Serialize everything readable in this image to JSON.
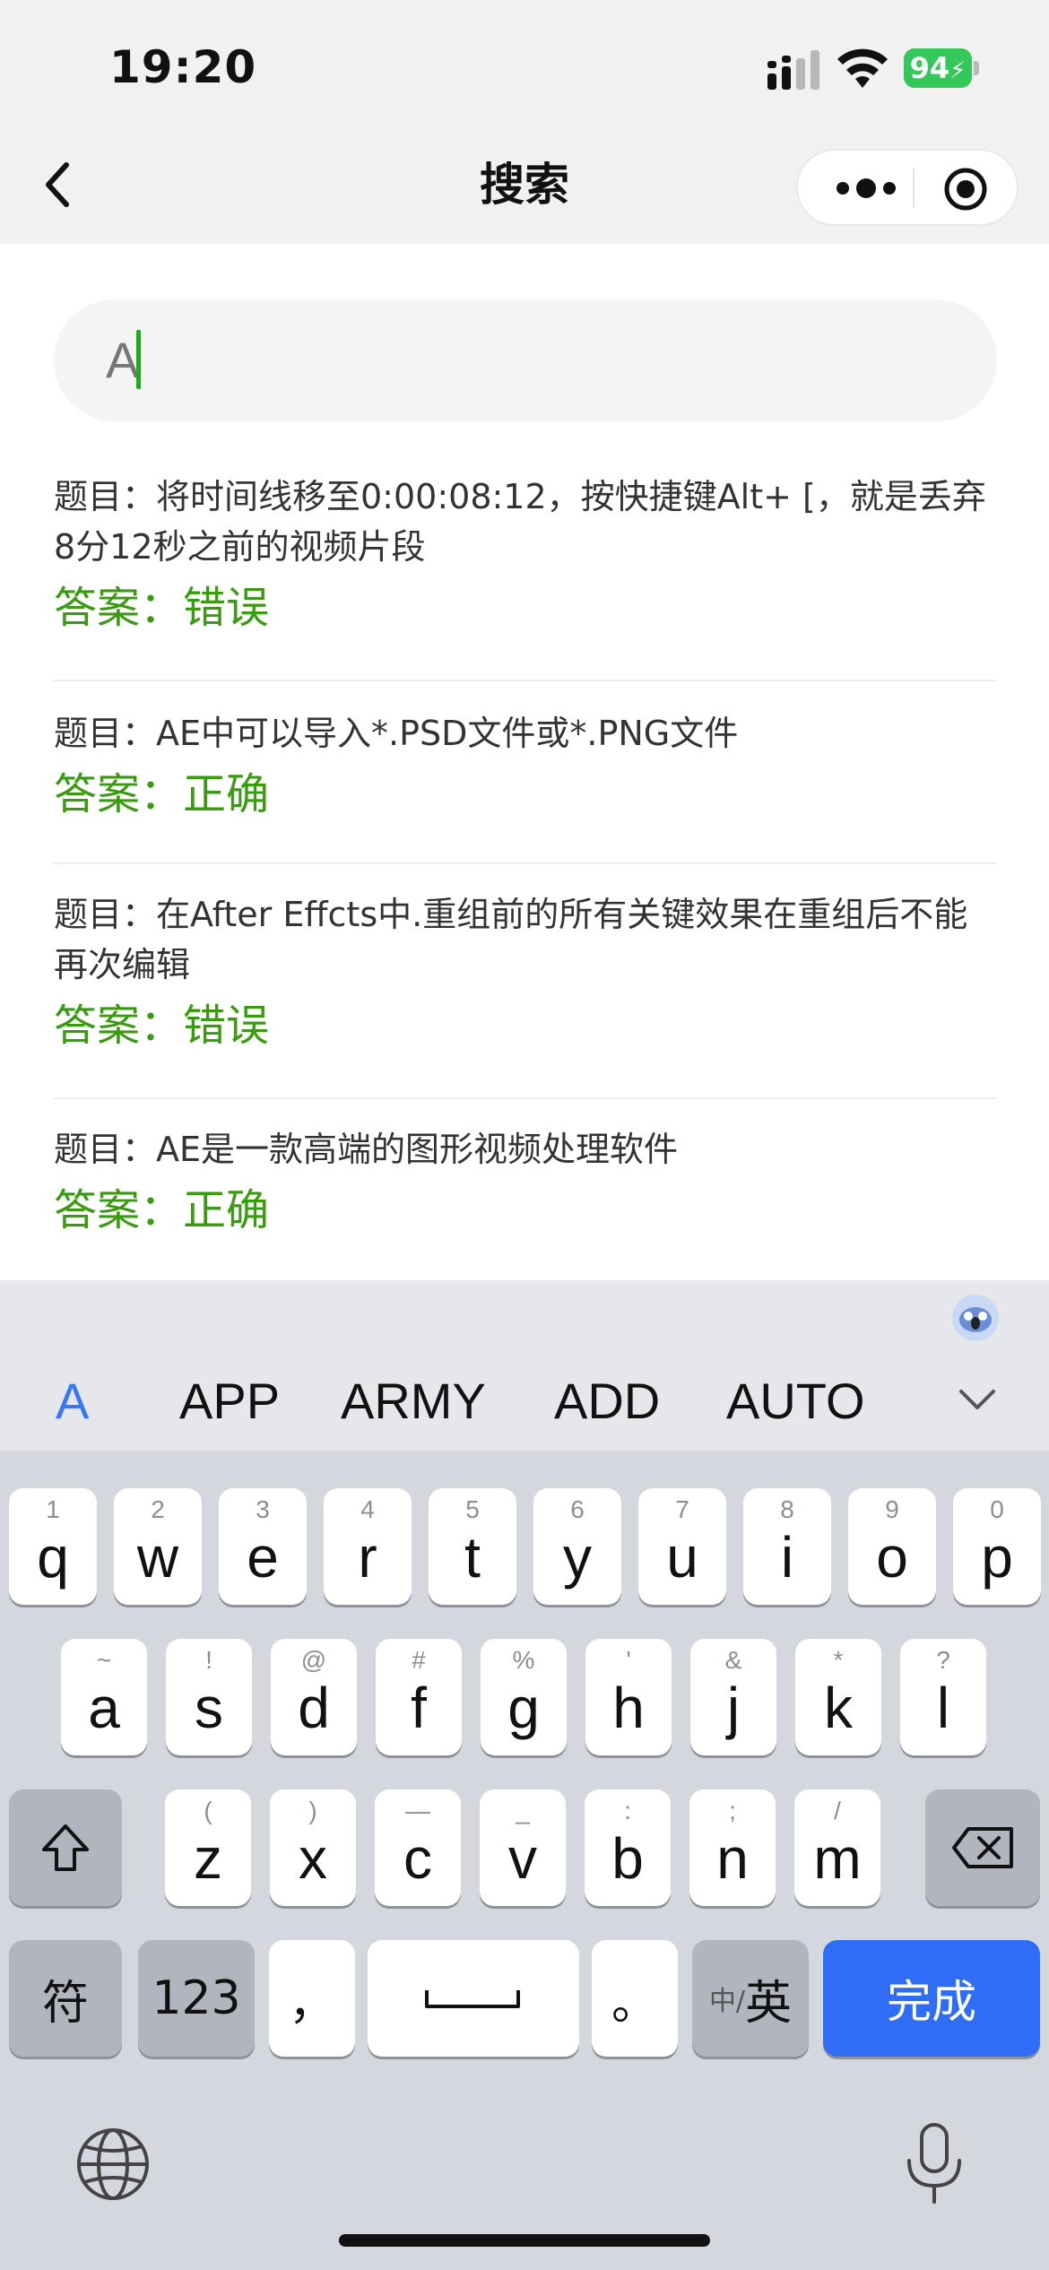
{
  "status_bar": {
    "time": "19:20",
    "battery": "94"
  },
  "nav": {
    "title": "搜索"
  },
  "search": {
    "value": "A"
  },
  "results": [
    {
      "question": "题目：将时间线移至0:00:08:12，按快捷键Alt+ [，就是丢弃8分12秒之前的视频片段",
      "answer": "答案：错误"
    },
    {
      "question": "题目：AE中可以导入*.PSD文件或*.PNG文件",
      "answer": "答案：正确"
    },
    {
      "question": "题目：在After Effcts中.重组前的所有关键效果在重组后不能再次编辑",
      "answer": "答案：错误"
    },
    {
      "question": "题目：AE是一款高端的图形视频处理软件",
      "answer": "答案：正确"
    }
  ],
  "keyboard": {
    "suggestions": [
      "A",
      "APP",
      "ARMY",
      "ADD",
      "AUTO"
    ],
    "row1": [
      {
        "k": "q",
        "h": "1"
      },
      {
        "k": "w",
        "h": "2"
      },
      {
        "k": "e",
        "h": "3"
      },
      {
        "k": "r",
        "h": "4"
      },
      {
        "k": "t",
        "h": "5"
      },
      {
        "k": "y",
        "h": "6"
      },
      {
        "k": "u",
        "h": "7"
      },
      {
        "k": "i",
        "h": "8"
      },
      {
        "k": "o",
        "h": "9"
      },
      {
        "k": "p",
        "h": "0"
      }
    ],
    "row2": [
      {
        "k": "a",
        "h": "~"
      },
      {
        "k": "s",
        "h": "!"
      },
      {
        "k": "d",
        "h": "@"
      },
      {
        "k": "f",
        "h": "#"
      },
      {
        "k": "g",
        "h": "%"
      },
      {
        "k": "h",
        "h": "'"
      },
      {
        "k": "j",
        "h": "&"
      },
      {
        "k": "k",
        "h": "*"
      },
      {
        "k": "l",
        "h": "?"
      }
    ],
    "row3": [
      {
        "k": "z",
        "h": "("
      },
      {
        "k": "x",
        "h": ")"
      },
      {
        "k": "c",
        "h": "—"
      },
      {
        "k": "v",
        "h": "_"
      },
      {
        "k": "b",
        "h": ":"
      },
      {
        "k": "n",
        "h": ";"
      },
      {
        "k": "m",
        "h": "/"
      }
    ],
    "symbols_label": "符",
    "numbers_label": "123",
    "comma_label": "，",
    "period_label": "。",
    "lang_small": "中/",
    "lang_big": "英",
    "done_label": "完成"
  }
}
